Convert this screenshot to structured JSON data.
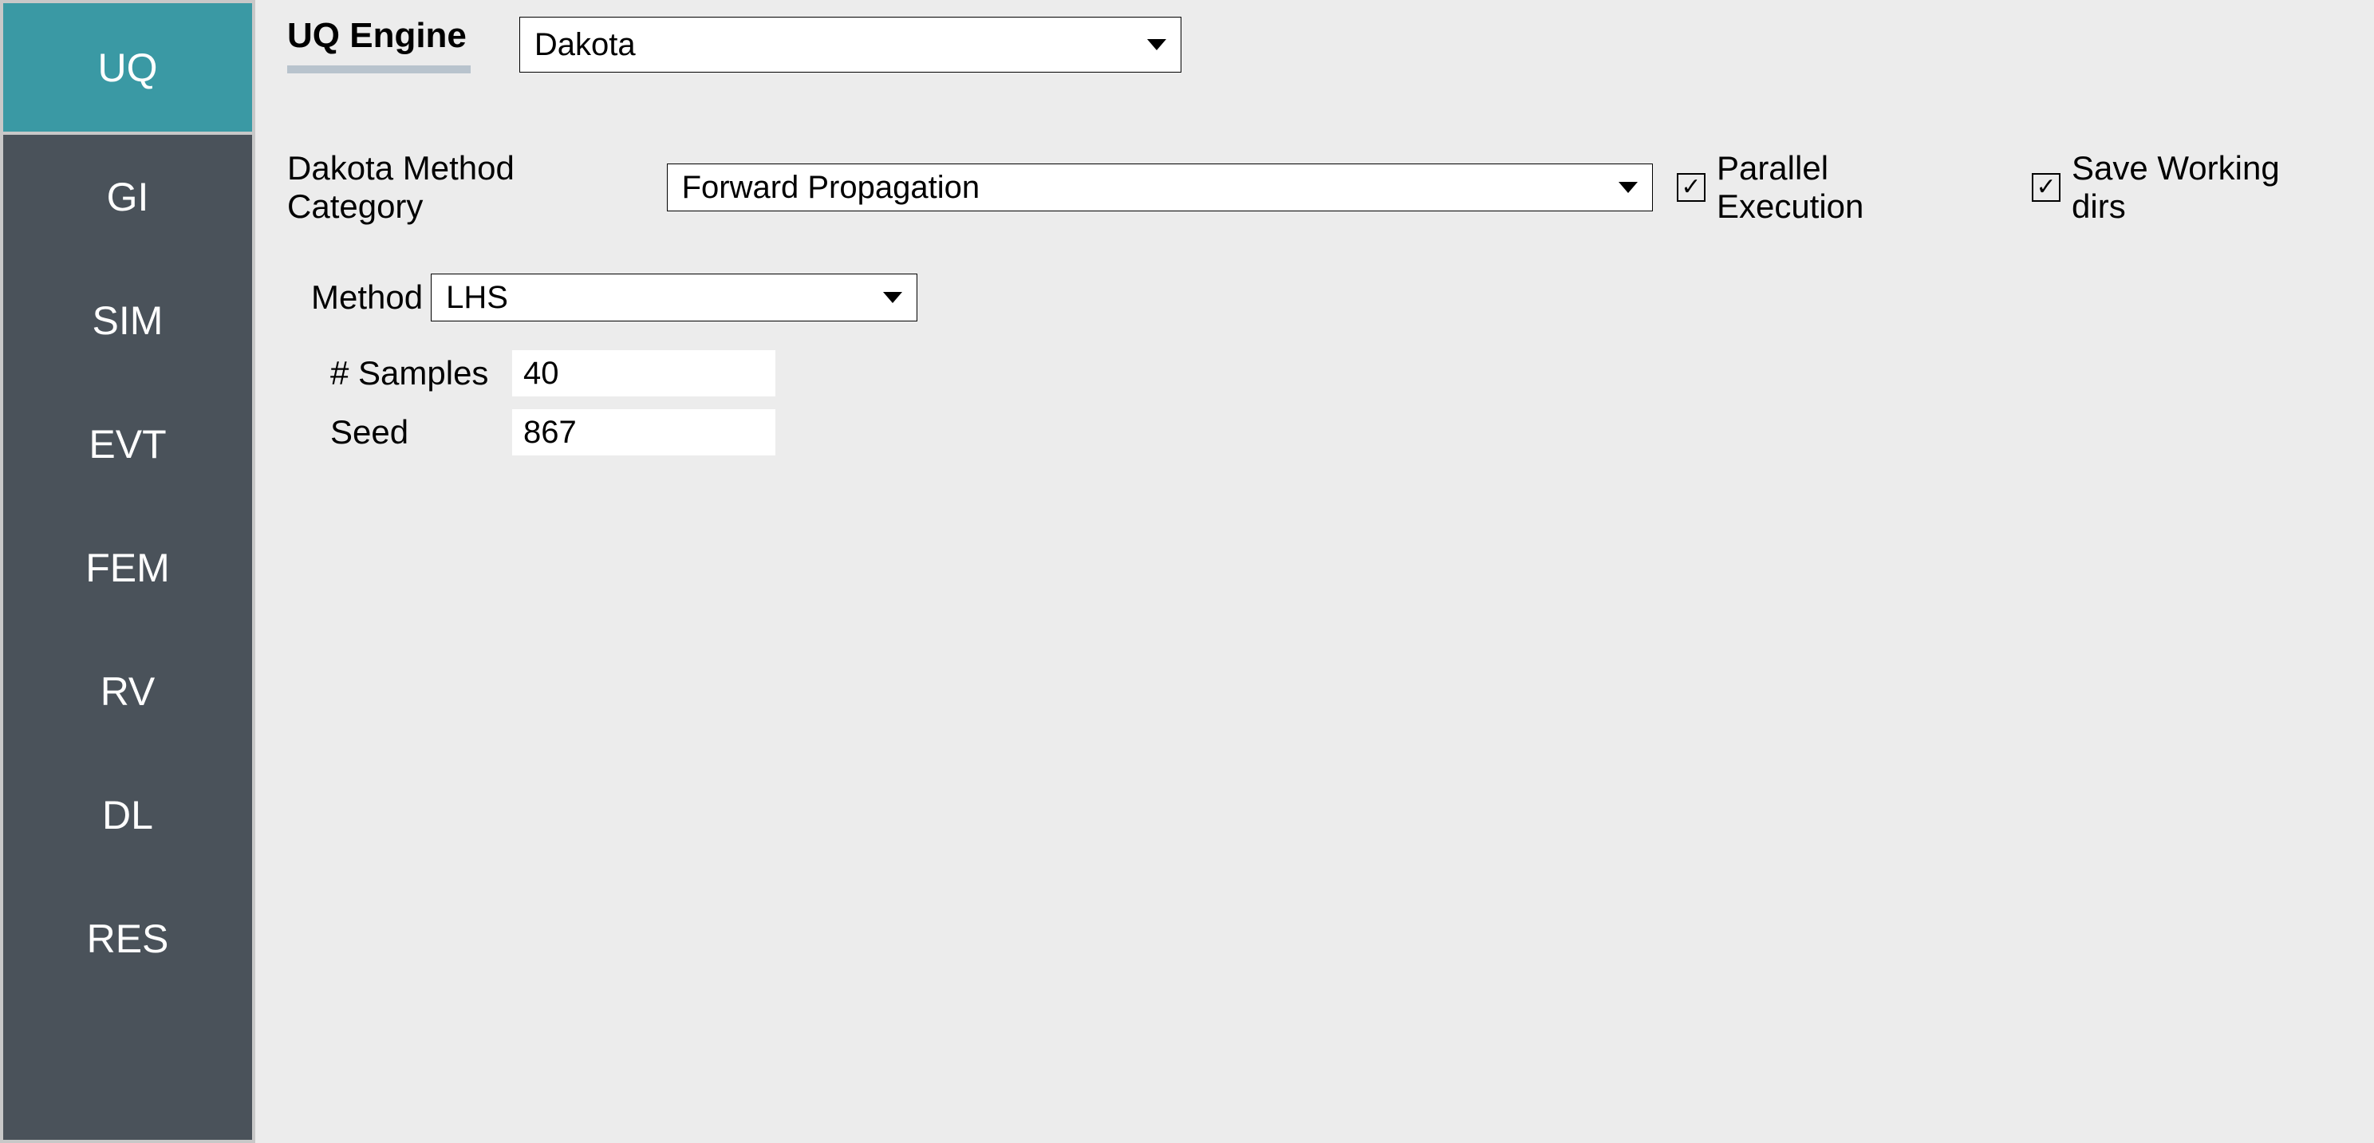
{
  "sidebar": {
    "items": [
      {
        "label": "UQ",
        "active": true
      },
      {
        "label": "GI",
        "active": false
      },
      {
        "label": "SIM",
        "active": false
      },
      {
        "label": "EVT",
        "active": false
      },
      {
        "label": "FEM",
        "active": false
      },
      {
        "label": "RV",
        "active": false
      },
      {
        "label": "DL",
        "active": false
      },
      {
        "label": "RES",
        "active": false
      }
    ]
  },
  "main": {
    "engine_title": "UQ Engine",
    "engine_value": "Dakota",
    "category_label": "Dakota Method Category",
    "category_value": "Forward Propagation",
    "checkbox_parallel": "Parallel Execution",
    "checkbox_save": "Save Working dirs",
    "method_label": "Method",
    "method_value": "LHS",
    "samples_label": "# Samples",
    "samples_value": "40",
    "seed_label": "Seed",
    "seed_value": "867"
  }
}
